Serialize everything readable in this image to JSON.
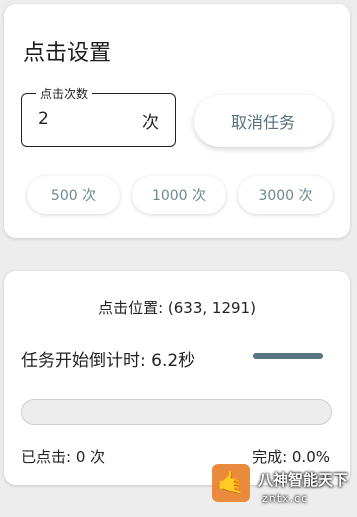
{
  "settings": {
    "title": "点击设置",
    "click_count": {
      "label": "点击次数",
      "value": "2",
      "suffix": "次"
    },
    "cancel_label": "取消任务",
    "presets": [
      "500 次",
      "1000 次",
      "3000 次"
    ]
  },
  "status": {
    "position": "点击位置: (633, 1291)",
    "countdown": "任务开始倒计时: 6.2秒",
    "progress_fraction": 0.0,
    "clicked": "已点击: 0 次",
    "complete": "完成: 0.0%"
  },
  "watermark": {
    "glyph": "🤙",
    "line1": "八神智能天下",
    "line2": "zntx.cc"
  },
  "colors": {
    "accent": "#587480",
    "button_text": "#55707c",
    "chip_text": "#6f8791",
    "watermark_logo": "#e98a3d"
  }
}
